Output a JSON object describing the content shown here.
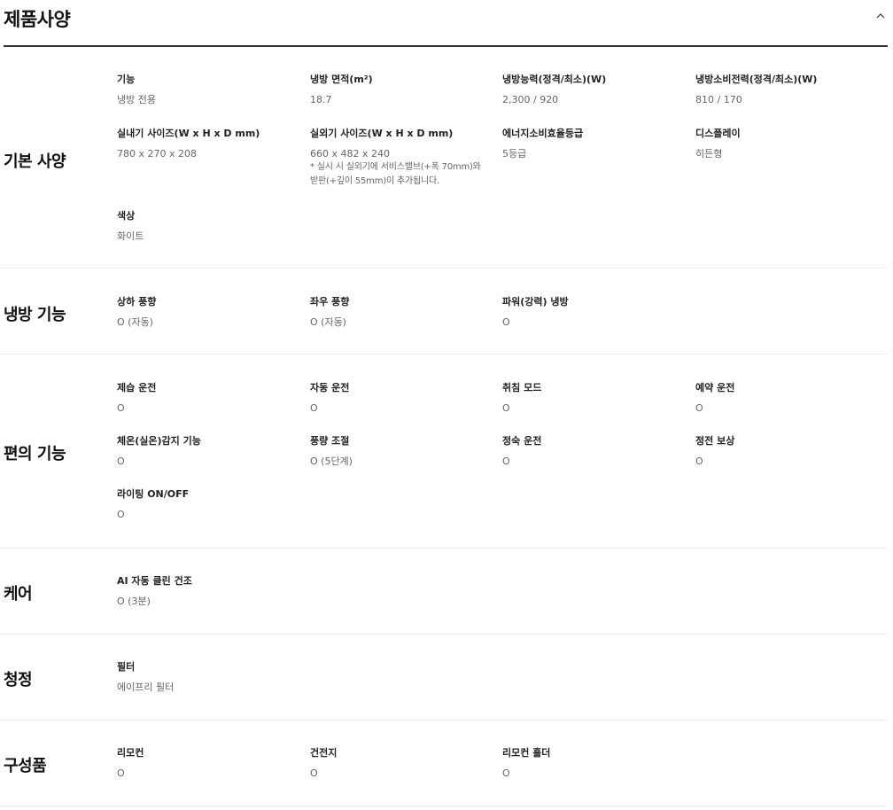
{
  "header": {
    "title": "제품사양"
  },
  "sections": [
    {
      "title": "기본 사양",
      "items": [
        {
          "label": "기능",
          "value": "냉방 전용"
        },
        {
          "label": "냉방 면적(m²)",
          "value": "18.7"
        },
        {
          "label": "냉방능력(정격/최소)(W)",
          "value": "2,300 / 920"
        },
        {
          "label": "냉방소비전력(정격/최소)(W)",
          "value": "810 / 170"
        },
        {
          "label": "실내기 사이즈(W x H x D mm)",
          "value": "780 x 270 x 208"
        },
        {
          "label": "실외기 사이즈(W x H x D mm)",
          "value": "660 x 482 x 240",
          "note": "* 실시 시 실외기에 서비스밸브(+폭 70mm)와\n받판(+깊이 55mm)이 추가됩니다."
        },
        {
          "label": "에너지소비효율등급",
          "value": "5등급"
        },
        {
          "label": "디스플레이",
          "value": "히든형"
        },
        {
          "label": "색상",
          "value": "화이트"
        }
      ]
    },
    {
      "title": "냉방 기능",
      "items": [
        {
          "label": "상하 풍향",
          "value": "O (자동)"
        },
        {
          "label": "좌우 풍향",
          "value": "O (자동)"
        },
        {
          "label": "파워(강력) 냉방",
          "value": "O"
        }
      ]
    },
    {
      "title": "편의 기능",
      "items": [
        {
          "label": "제습 운전",
          "value": "O"
        },
        {
          "label": "자동 운전",
          "value": "O"
        },
        {
          "label": "취침 모드",
          "value": "O"
        },
        {
          "label": "예약 운전",
          "value": "O"
        },
        {
          "label": "체온(실온)감지 기능",
          "value": "O"
        },
        {
          "label": "풍량 조절",
          "value": "O (5단계)"
        },
        {
          "label": "정숙 운전",
          "value": "O"
        },
        {
          "label": "정전 보상",
          "value": "O"
        },
        {
          "label": "라이팅 ON/OFF",
          "value": "O"
        }
      ]
    },
    {
      "title": "케어",
      "items": [
        {
          "label": "AI 자동 클린 건조",
          "value": "O (3분)"
        }
      ]
    },
    {
      "title": "청정",
      "items": [
        {
          "label": "필터",
          "value": "에이프리 필터"
        }
      ]
    },
    {
      "title": "구성품",
      "items": [
        {
          "label": "리모컨",
          "value": "O"
        },
        {
          "label": "건전지",
          "value": "O"
        },
        {
          "label": "리모컨 홀더",
          "value": "O"
        }
      ]
    }
  ],
  "icons": {
    "collapse": "chevron-up-icon"
  },
  "colors": {
    "header_rule": "#333333",
    "section_rule": "#eeeeee",
    "label": "#222222",
    "value": "#666666"
  }
}
